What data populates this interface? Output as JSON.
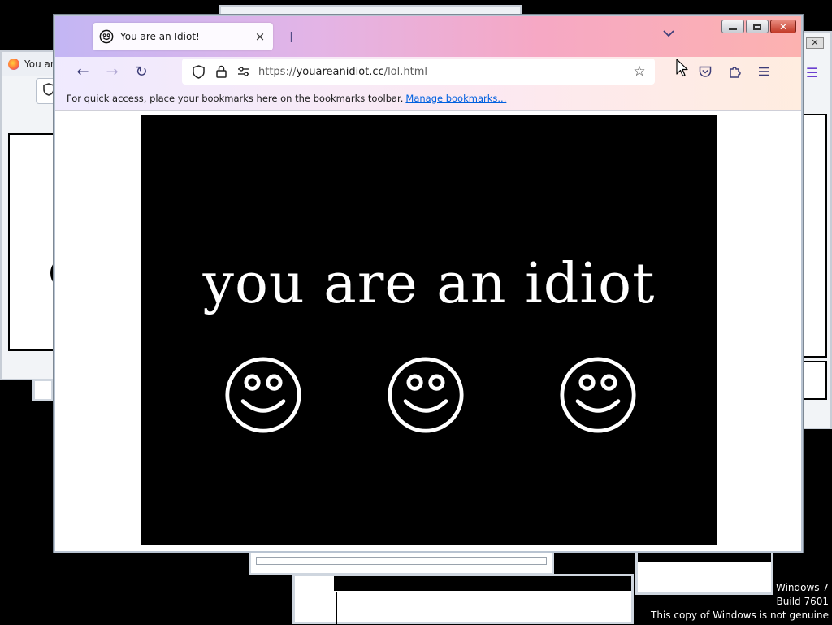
{
  "background": {
    "left_window_tab_label": "You ar"
  },
  "window": {
    "tab": {
      "title": "You are an Idiot!",
      "icon": "smiley-icon",
      "close_glyph": "×"
    },
    "new_tab_glyph": "+",
    "tab_list_glyph": "⌄",
    "controls": {
      "close_glyph": "✕"
    },
    "nav": {
      "back_glyph": "←",
      "forward_glyph": "→",
      "reload_glyph": "↻"
    },
    "urlbar": {
      "scheme": "https://",
      "host": "youareanidiot.cc",
      "path": "/lol.html",
      "bookmark_glyph": "☆"
    },
    "bookmarks_bar": {
      "message": "For quick access, place your bookmarks here on the bookmarks toolbar.",
      "link": "Manage bookmarks..."
    }
  },
  "page_content": {
    "headline": "you are an idiot",
    "smiley_count": 3,
    "colors": {
      "background": "#000000",
      "foreground": "#ffffff"
    }
  },
  "watermark": {
    "line1": "Windows 7",
    "line2": "Build 7601",
    "line3": "This copy of Windows is not genuine"
  },
  "colors": {
    "accent": "#3d3d78",
    "link": "#0060df",
    "close_red": "#c23a27"
  }
}
